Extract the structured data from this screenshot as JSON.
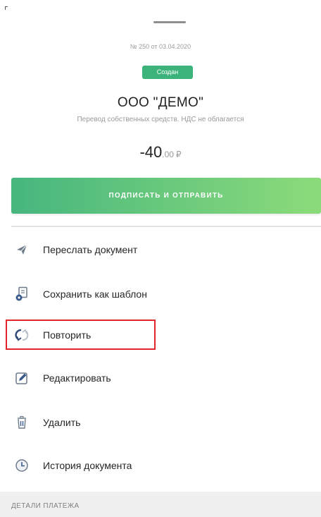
{
  "document": {
    "number_line": "№ 250 от 03.04.2020",
    "status": "Создан",
    "company": "ООО \"ДЕМО\"",
    "purpose": "Перевод собственных средств. НДС не облагается",
    "amount": {
      "integer": "-40",
      "fraction": ".00",
      "currency": "₽"
    }
  },
  "actions": {
    "sign_label": "ПОДПИСАТЬ И ОТПРАВИТЬ"
  },
  "menu": {
    "items": [
      {
        "label": "Переслать документ",
        "icon": "send-plane-icon"
      },
      {
        "label": "Сохранить как шаблон",
        "icon": "save-template-icon"
      },
      {
        "label": "Повторить",
        "icon": "repeat-icon"
      },
      {
        "label": "Редактировать",
        "icon": "edit-pencil-icon"
      },
      {
        "label": "Удалить",
        "icon": "trash-icon"
      },
      {
        "label": "История документа",
        "icon": "history-clock-icon"
      }
    ]
  },
  "details": {
    "label": "ДЕТАЛИ ПЛАТЕЖА"
  },
  "colors": {
    "status_green": "#3bb37a",
    "button_gradient_start": "#46b67f",
    "button_gradient_end": "#8cdb7a",
    "highlight_red": "#e2262b",
    "icon_blue": "#3b5b8c"
  }
}
